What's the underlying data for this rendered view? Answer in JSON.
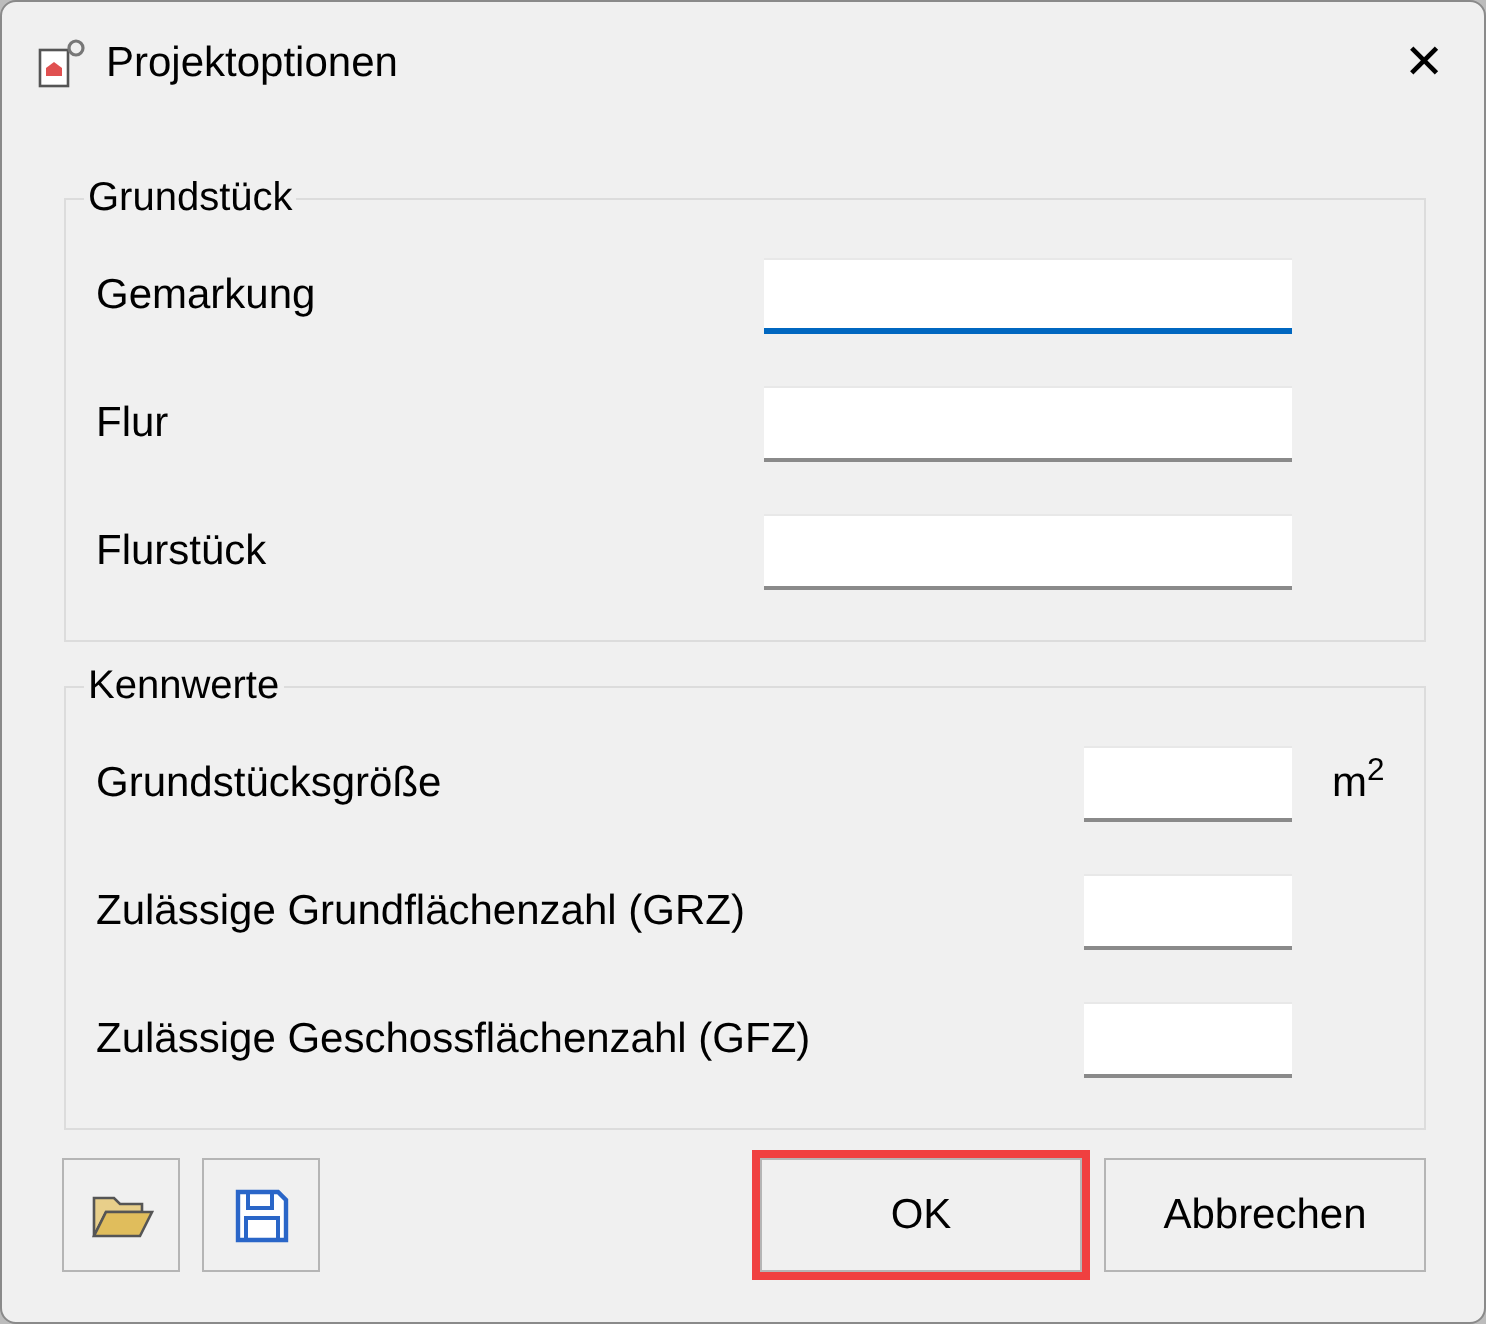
{
  "window": {
    "title": "Projektoptionen",
    "close": "✕"
  },
  "groups": [
    {
      "title": "Grundstück",
      "fields": [
        {
          "label": "Gemarkung",
          "kind": "wide",
          "focused": true
        },
        {
          "label": "Flur",
          "kind": "wide",
          "focused": false
        },
        {
          "label": "Flurstück",
          "kind": "wide",
          "focused": false
        }
      ]
    },
    {
      "title": "Kennwerte",
      "fields": [
        {
          "label": "Grundstücksgröße",
          "kind": "narrow",
          "focused": false,
          "unit": "m$^{2}$"
        },
        {
          "label": "Zulässige Grundflächenzahl (GRZ)",
          "kind": "narrow",
          "focused": false
        },
        {
          "label": "Zulässige Geschossflächenzahl (GFZ)",
          "kind": "narrow",
          "focused": false
        }
      ]
    }
  ],
  "tool_buttons": [
    {
      "kind": "open"
    },
    {
      "kind": "save"
    }
  ],
  "buttons": [
    {
      "label": "OK",
      "highlighted": true
    },
    {
      "label": "Abbrechen",
      "highlighted": false
    }
  ]
}
